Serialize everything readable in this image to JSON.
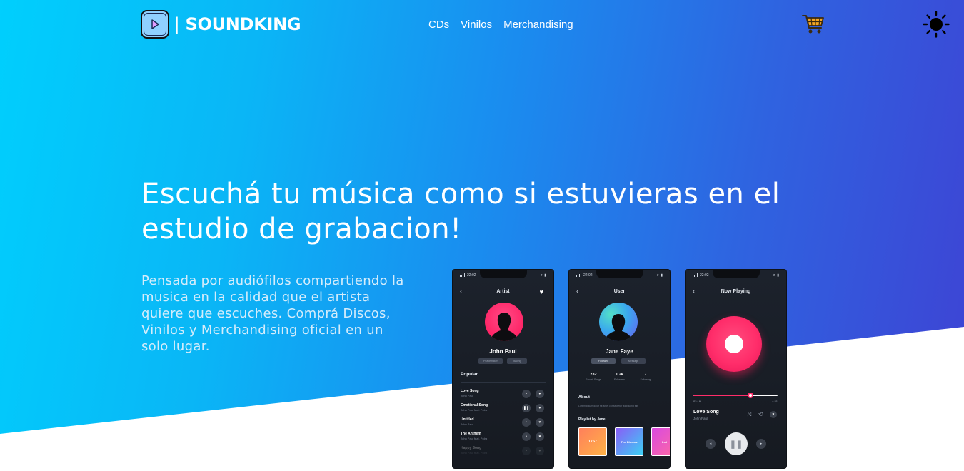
{
  "brand": {
    "name": "| SOUNDKING",
    "logo_icon": "play-triangle-icon"
  },
  "nav": {
    "links": [
      "CDs",
      "Vinilos",
      "Merchandising"
    ]
  },
  "header_icons": {
    "cart": "shopping-cart-icon",
    "theme": "sun-icon"
  },
  "hero": {
    "title": "Escuchá tu música como si estuvieras en el estudio de grabacion!",
    "description": "Pensada por audiófilos compartiendo la musica en la calidad que el artista quiere que escuches. Comprá Discos, Vinilos y Merchandising oficial en un solo lugar."
  },
  "colors": {
    "gradient_start": "#00cffd",
    "gradient_end": "#3e43d4",
    "accent_pink": "#ff2d6a"
  },
  "phones": {
    "status_time": "22:02",
    "artist": {
      "screen_title": "Artist",
      "name": "John Paul",
      "chips": [
        "Peacemaker",
        "Mailing"
      ],
      "section": "Popular",
      "songs": [
        {
          "title": "Love Song",
          "artist": "John Paul"
        },
        {
          "title": "Emotional Song",
          "artist": "John Paul feat. Polra"
        },
        {
          "title": "Untitled",
          "artist": "John Paul"
        },
        {
          "title": "The Anthem",
          "artist": "John Paul feat. Polra"
        },
        {
          "title": "Happy Song",
          "artist": "John Paul feat. Polra"
        }
      ]
    },
    "user": {
      "screen_title": "User",
      "name": "Jane Faye",
      "chips": [
        "Followed",
        "Message"
      ],
      "stats": [
        {
          "value": "232",
          "label": "Favorit Songs"
        },
        {
          "value": "1.2k",
          "label": "Followers"
        },
        {
          "value": "7",
          "label": "Following"
        }
      ],
      "about_heading": "About",
      "about_text": "Lorem ipsum dolor sit amet consectetur adipiscing elit",
      "playlist_heading": "Playlist by Jane",
      "playlists": [
        "1767",
        "The Blooms",
        "Indi"
      ]
    },
    "now_playing": {
      "screen_title": "Now Playing",
      "elapsed": "02:19",
      "remaining": "-4:21",
      "progress": 0.68,
      "song": "Love Song",
      "artist": "John Paul"
    }
  }
}
